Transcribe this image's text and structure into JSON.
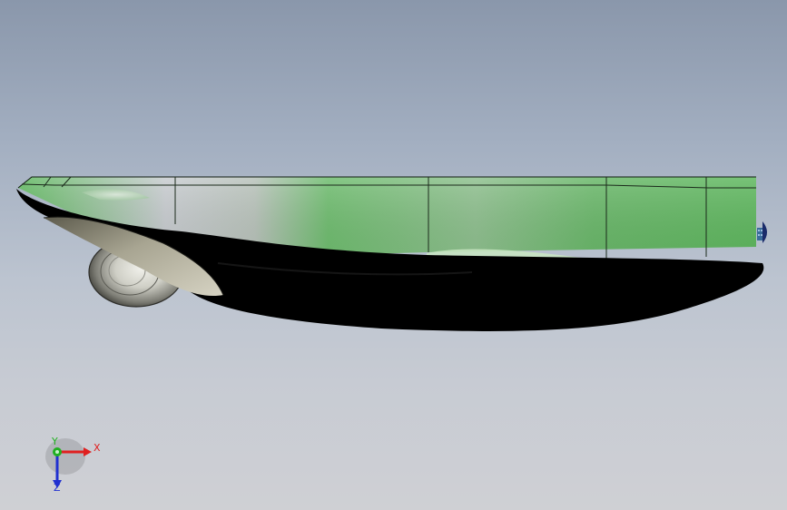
{
  "viewport": {
    "background_top": "#8a97ab",
    "background_bottom": "#cfd0d4"
  },
  "model": {
    "body_color": "#6cc06c",
    "shell_color": "#000000",
    "fairing_color": "#9a9684",
    "wheel_color": "#b8b8b0"
  },
  "triad": {
    "x_label": "X",
    "y_label": "Y",
    "z_label": "Z",
    "x_color": "#e02020",
    "y_color": "#20b020",
    "z_color": "#2030d0"
  }
}
